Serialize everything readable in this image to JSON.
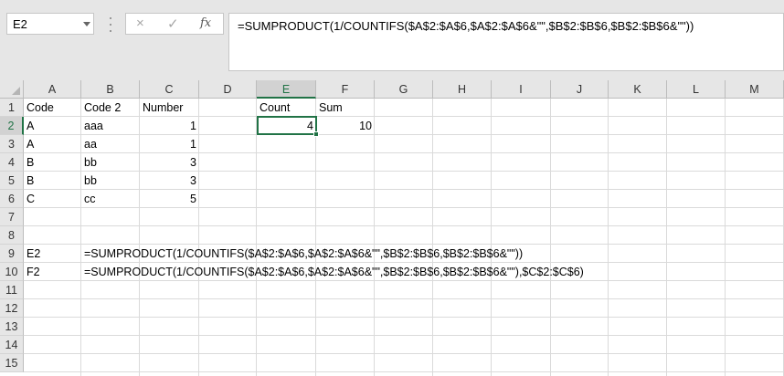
{
  "name_box": {
    "value": "E2"
  },
  "formula_bar": {
    "cancel_icon": "×",
    "enter_icon": "✓",
    "fx_label": "fx",
    "formula": "=SUMPRODUCT(1/COUNTIFS($A$2:$A$6,$A$2:$A$6&\"\",$B$2:$B$6,$B$2:$B$6&\"\"))"
  },
  "columns": [
    "A",
    "B",
    "C",
    "D",
    "E",
    "F",
    "G",
    "H",
    "I",
    "J",
    "K",
    "L",
    "M"
  ],
  "rows": [
    "1",
    "2",
    "3",
    "4",
    "5",
    "6",
    "7",
    "8",
    "9",
    "10",
    "11",
    "12",
    "13",
    "14",
    "15"
  ],
  "selected_column": "E",
  "selected_row": "2",
  "cells": {
    "A1": "Code",
    "B1": "Code 2",
    "C1": "Number",
    "E1": "Count",
    "F1": "Sum",
    "A2": "A",
    "B2": "aaa",
    "C2": "1",
    "E2": "4",
    "F2": "10",
    "A3": "A",
    "B3": "aa",
    "C3": "1",
    "A4": "B",
    "B4": "bb",
    "C4": "3",
    "A5": "B",
    "B5": "bb",
    "C5": "3",
    "A6": "C",
    "B6": "cc",
    "C6": "5",
    "A9": "E2",
    "B9": "=SUMPRODUCT(1/COUNTIFS($A$2:$A$6,$A$2:$A$6&\"\",$B$2:$B$6,$B$2:$B$6&\"\"))",
    "A10": "F2",
    "B10": "=SUMPRODUCT(1/COUNTIFS($A$2:$A$6,$A$2:$A$6&\"\",$B$2:$B$6,$B$2:$B$6&\"\"),$C$2:$C$6)"
  },
  "colors": {
    "accent": "#217346",
    "header_bg": "#e6e6e6",
    "gridline": "#dadada"
  }
}
